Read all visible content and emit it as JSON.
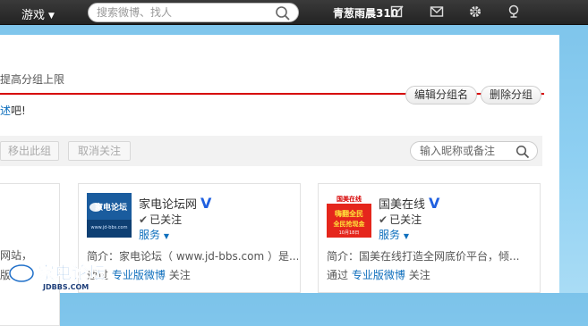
{
  "topbar": {
    "game_label": "游戏",
    "search_placeholder": "搜索微博、找人",
    "username": "青葱雨晨310"
  },
  "group": {
    "tip_top": "提高分组上限",
    "edit_group": "编辑分组名",
    "delete_group": "删除分组",
    "tip_link": "述",
    "tip_suffix": "吧!"
  },
  "actions": {
    "move_out": "移出此组",
    "unfollow": "取消关注",
    "search_placeholder": "输入昵称或备注"
  },
  "left_card": {
    "desc_tail": "网站，",
    "via_tail": "版"
  },
  "cards": [
    {
      "name": "家电论坛网",
      "verified": "V",
      "follow_state": "已关注",
      "service": "服务",
      "desc": "简介：家电论坛（ www.jd-bbs.com ）是...",
      "via_prefix": "通过",
      "via_link": "专业版微博",
      "via_action": "关注",
      "avatar_text": "家电论坛",
      "avatar_sub": "www.jd-bbs.com"
    },
    {
      "name": "国美在线",
      "verified": "V",
      "follow_state": "已关注",
      "service": "服务",
      "desc": "简介：国美在线打造全网底价平台，倾...",
      "via_prefix": "通过",
      "via_link": "专业版微博",
      "via_action": "关注",
      "avatar_brand": "国美在线",
      "avatar_line1": "嗨翻全民",
      "avatar_line2": "全民抢现金",
      "avatar_date": "10月18日"
    }
  ],
  "watermark": {
    "cn": "家电论坛",
    "en": "JDBBS.COM"
  },
  "colors": {
    "accent_red": "#d60000",
    "link_blue": "#0f6fbd",
    "verified_blue": "#2060e0",
    "topbar_bg": "#2b2b2b"
  }
}
